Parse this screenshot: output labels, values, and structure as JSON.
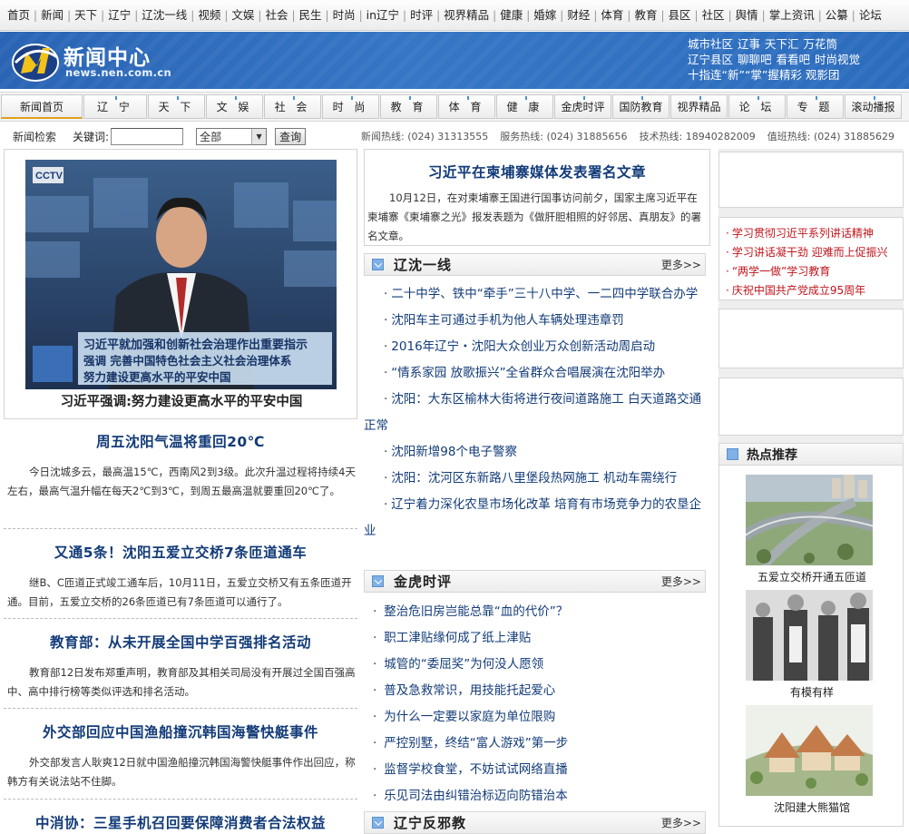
{
  "top_nav": [
    "首页",
    "新闻",
    "天下",
    "辽宁",
    "辽沈一线",
    "视频",
    "文娱",
    "社会",
    "民生",
    "时尚",
    "in辽宁",
    "时评",
    "视界精品",
    "健康",
    "婚嫁",
    "财经",
    "体育",
    "教育",
    "县区",
    "社区",
    "舆情",
    "掌上资讯",
    "公纂",
    "论坛"
  ],
  "header": {
    "logo_title": "新闻中心",
    "logo_url": "news.nen.com.cn",
    "links_row1": [
      "城市社区",
      "辽事",
      "天下汇",
      "万花筒"
    ],
    "links_row2": [
      "辽宁县区",
      "聊聊吧",
      "看看吧",
      "时尚视觉"
    ],
    "links_row3": "十指连“新”“掌”握精彩 观影团"
  },
  "channels": [
    "新闻首页",
    "辽 宁",
    "天 下",
    "文 娱",
    "社 会",
    "时 尚",
    "教 育",
    "体 育",
    "健 康",
    "金虎时评",
    "国防教育",
    "视界精品",
    "论 坛",
    "专 题",
    "滚动播报"
  ],
  "search": {
    "label": "新闻检索",
    "keyword_label": "关键词:",
    "keyword_value": "",
    "scope": "全部",
    "button": "查询"
  },
  "hotlines": [
    "新闻热线: (024) 31313555",
    "服务热线: (024) 31885656",
    "技术热线: 18940282009",
    "值班热线: (024) 31885629"
  ],
  "feature": {
    "screen_lines": [
      "习近平就加强和创新社会治理作出重要指示",
      "强调 完善中国特色社会主义社会治理体系",
      "努力建设更高水平的平安中国"
    ],
    "caption": "习近平强调:努力建设更高水平的平安中国"
  },
  "left_news": [
    {
      "title": "周五沈阳气温将重回20℃",
      "summary": "今日沈城多云，最高温15℃，西南风2到3级。此次升温过程将持续4天左右，最高气温升幅在每天2℃到3℃，到周五最高温就要重回20℃了。"
    },
    {
      "title": "又通5条！沈阳五爱立交桥7条匝道通车",
      "summary": "继B、C匝道正式竣工通车后，10月11日，五爱立交桥又有五条匝道开通。目前，五爱立交桥的26条匝道已有7条匝道可以通行了。"
    },
    {
      "title": "教育部：从未开展全国中学百强排名活动",
      "summary": "教育部12日发布郑重声明，教育部及其相关司局没有开展过全国百强高中、高中排行榜等类似评选和排名活动。"
    },
    {
      "title": "外交部回应中国渔船撞沉韩国海警快艇事件",
      "summary": "外交部发言人耿爽12日就中国渔船撞沉韩国海警快艇事件作出回应，称韩方有关说法站不住脚。"
    },
    {
      "title": "中消协：三星手机召回要保障消费者合法权益",
      "summary": ""
    }
  ],
  "top_story": {
    "title": "习近平在柬埔寨媒体发表署名文章",
    "summary": "10月12日，在对柬埔寨王国进行国事访问前夕，国家主席习近平在柬埔寨《柬埔寨之光》报发表题为《做肝胆相照的好邻居、真朋友》的署名文章。"
  },
  "sections": [
    {
      "title": "辽沈一线",
      "more": "更多>>",
      "items": [
        "二十中学、铁中“牵手”三十八中学、一二四中学联合办学",
        "沈阳车主可通过手机为他人车辆处理违章罚",
        "2016年辽宁・沈阳大众创业万众创新活动周启动",
        "“情系家园 放歌振兴”全省群众合唱展演在沈阳举办",
        "沈阳：大东区榆林大街将进行夜间道路施工 白天道路交通正常",
        "沈阳新增98个电子警察",
        "沈阳：沈河区东新路八里堡段热网施工 机动车需绕行",
        "辽宁着力深化农垦市场化改革 培育有市场竞争力的农垦企业"
      ]
    },
    {
      "title": "金虎时评",
      "more": "更多>>",
      "items": [
        "整治危旧房岂能总靠“血的代价”？",
        "职工津贴缘何成了纸上津贴",
        "城管的“委屈奖”为何没人愿领",
        "普及急救常识，用技能托起爱心",
        "为什么一定要以家庭为单位限购",
        "严控别墅，终结“富人游戏”第一步",
        "监督学校食堂，不妨试试网络直播",
        "乐见司法由纠错治标迈向防错治本"
      ]
    },
    {
      "title": "辽宁反邪教",
      "more": "更多>>",
      "items": []
    }
  ],
  "topics": [
    "学习贯彻习近平系列讲话精神",
    "学习讲话凝干劲 迎难而上促振兴",
    "“两学一做”学习教育",
    "庆祝中国共产党成立95周年"
  ],
  "hot": {
    "title": "热点推荐",
    "items": [
      "五爱立交桥开通五匝道",
      "有模有样",
      "沈阳建大熊猫馆"
    ]
  },
  "colors": {
    "header_blue": "#2c6cbd",
    "title_blue": "#123b78",
    "topic_red": "#c0141b"
  }
}
